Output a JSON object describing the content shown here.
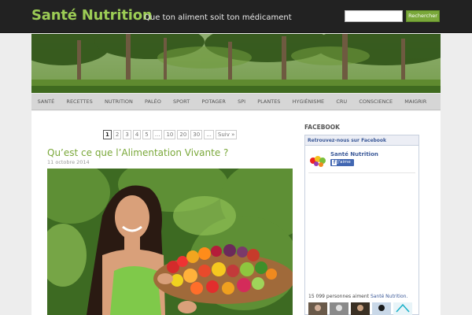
{
  "header": {
    "site_title": "Santé Nutrition",
    "tagline": "Que ton aliment soit ton médicament",
    "search_button": "Rechercher"
  },
  "nav": {
    "items": [
      "SANTÉ",
      "RECETTES",
      "NUTRITION",
      "PALÉO",
      "SPORT",
      "POTAGER",
      "SPI",
      "PLANTES",
      "HYGIÉNISME",
      "CRU",
      "CONSCIENCE",
      "MAIGRIR"
    ]
  },
  "pagination": {
    "pages": [
      "1",
      "2",
      "3",
      "4",
      "5",
      "...",
      "10",
      "20",
      "30",
      "...",
      "Suiv »"
    ],
    "current": "1"
  },
  "post": {
    "title": "Qu’est ce que l’Alimentation Vivante ?",
    "date": "11 octobre 2014"
  },
  "sidebar": {
    "title": "FACEBOOK",
    "fb_header": "Retrouvez-nous sur Facebook",
    "fb_page_name": "Santé Nutrition",
    "fb_like": "J'aime",
    "fb_count_text": "15 099 personnes aiment ",
    "fb_count_link": "Santé Nutrition."
  }
}
